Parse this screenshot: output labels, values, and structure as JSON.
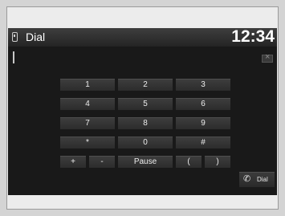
{
  "header": {
    "title": "Dial",
    "clock": "12:34"
  },
  "keypad": {
    "keys": [
      "1",
      "2",
      "3",
      "4",
      "5",
      "6",
      "7",
      "8",
      "9",
      "*",
      "0",
      "#"
    ],
    "bottom_row": [
      "+",
      "-",
      "Pause",
      "(",
      ")"
    ]
  },
  "dial_button": {
    "label": "Dial"
  },
  "icons": {
    "header": "phone-icon",
    "delete": "backspace-icon",
    "dial": "handset-icon"
  },
  "colors": {
    "screen_bg": "#191919",
    "key_bg": "#353535",
    "text": "#ececec"
  }
}
